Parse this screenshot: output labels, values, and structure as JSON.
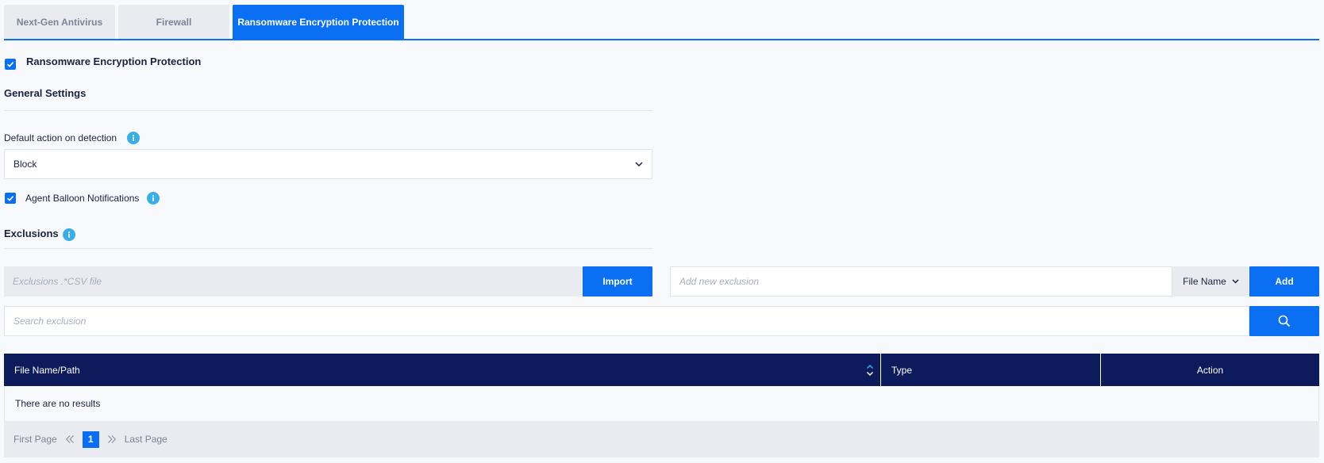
{
  "tabs": [
    {
      "label": "Next-Gen Antivirus",
      "active": false
    },
    {
      "label": "Firewall",
      "active": false
    },
    {
      "label": "Ransomware Encryption Protection",
      "active": true
    }
  ],
  "feature": {
    "label": "Ransomware Encryption Protection",
    "checked": true
  },
  "general_settings": {
    "title": "General Settings",
    "default_action_label": "Default action on detection",
    "default_action_value": "Block",
    "balloon_label": "Agent Balloon Notifications",
    "balloon_checked": true
  },
  "exclusions": {
    "title": "Exclusions",
    "csv_placeholder": "Exclusions .*CSV file",
    "import_label": "Import",
    "add_placeholder": "Add new exclusion",
    "type_value": "File Name",
    "add_label": "Add",
    "search_placeholder": "Search exclusion"
  },
  "table": {
    "columns": [
      "File Name/Path",
      "Type",
      "Action"
    ],
    "empty_text": "There are no results"
  },
  "pagination": {
    "first_label": "First Page",
    "current_page": "1",
    "last_label": "Last Page"
  },
  "colors": {
    "accent": "#0a6ff2",
    "header": "#0d1a5c",
    "info": "#3aaee6"
  }
}
